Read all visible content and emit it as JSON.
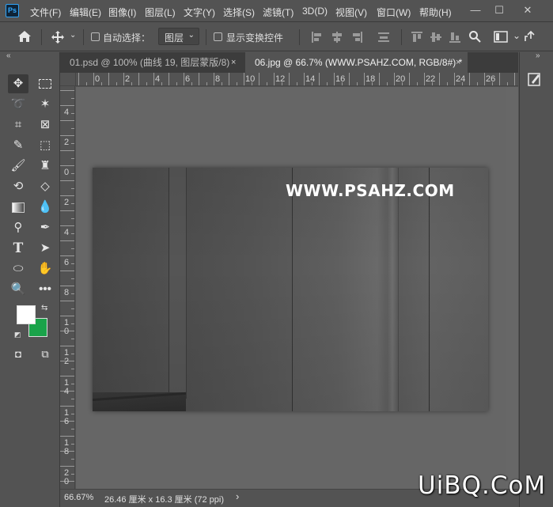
{
  "app": {
    "logo": "Ps"
  },
  "menu": [
    "文件(F)",
    "编辑(E)",
    "图像(I)",
    "图层(L)",
    "文字(Y)",
    "选择(S)",
    "滤镜(T)",
    "3D(D)",
    "视图(V)",
    "窗口(W)",
    "帮助(H)"
  ],
  "window_buttons": {
    "minimize": "—",
    "maximize": "☐",
    "close": "✕"
  },
  "options": {
    "auto_select_label": "自动选择：",
    "auto_select_value": "图层",
    "show_transform_label": "显示变换控件"
  },
  "tabs": [
    {
      "label": "01.psd @ 100% (曲线 19, 图层蒙版/8)",
      "close": "×"
    },
    {
      "label": "06.jpg @ 66.7% (WWW.PSAHZ.COM, RGB/8#) *",
      "close": "×"
    }
  ],
  "hruler_labels": [
    "0",
    "2",
    "4",
    "6",
    "8",
    "10",
    "12",
    "14",
    "16",
    "18",
    "20",
    "22",
    "24",
    "26"
  ],
  "vruler_labels": [
    "4",
    "2",
    "0",
    "2",
    "4",
    "6",
    "8",
    "1 0",
    "1 2",
    "1 4",
    "1 6",
    "1 8",
    "2 0"
  ],
  "canvas": {
    "watermark": "WWW.PSAHZ.COM"
  },
  "colors": {
    "foreground": "#ffffff",
    "background": "#1aa34a",
    "ui_bg": "#535353",
    "workspace": "#666666"
  },
  "status": {
    "zoom": "66.67%",
    "doc_info": "26.46 厘米 x 16.3 厘米 (72 ppi)",
    "arrow": "›"
  },
  "watermark_brand": "UiBQ.CoM"
}
